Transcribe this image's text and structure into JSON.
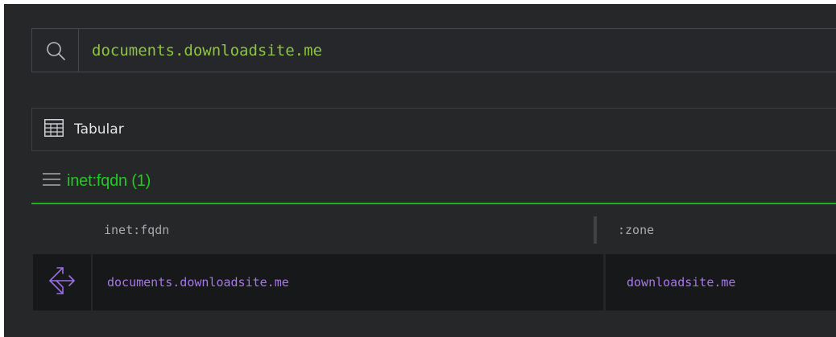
{
  "search": {
    "value": "documents.downloadsite.me",
    "icon": "search-icon"
  },
  "view": {
    "label": "Tabular",
    "icon": "table-icon"
  },
  "results": {
    "title": "inet:fqdn (1)",
    "icon": "menu-icon",
    "accent_color": "#22c922",
    "columns": [
      "inet:fqdn",
      ":zone"
    ],
    "rows": [
      {
        "icon": "fqdn-node-icon",
        "cells": [
          "documents.downloadsite.me",
          "downloadsite.me"
        ]
      }
    ]
  },
  "colors": {
    "background": "#262729",
    "search_text": "#8cc63f",
    "cell_text": "#a678e6",
    "header_text": "#a8aab0"
  }
}
